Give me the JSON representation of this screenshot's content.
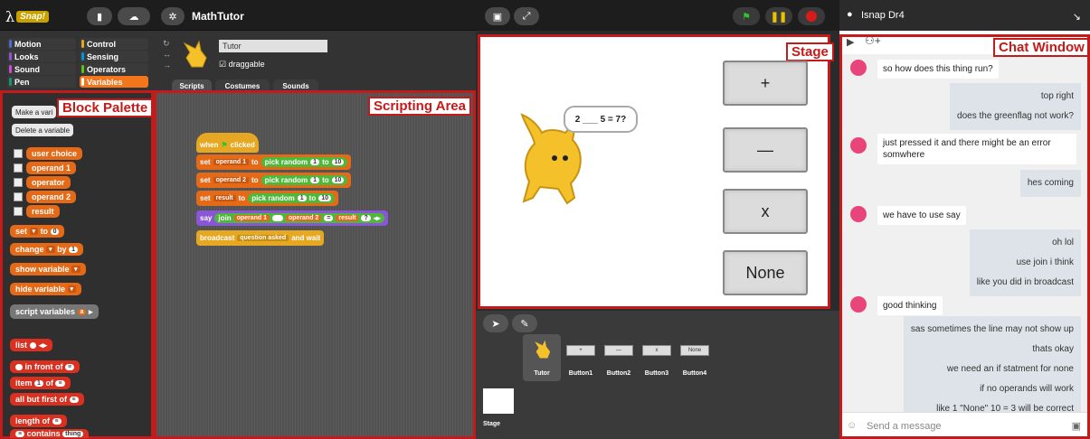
{
  "toolbar": {
    "logo": "Snap!",
    "project_name": "MathTutor"
  },
  "categories": [
    {
      "label": "Motion",
      "color": "#4a6cd4"
    },
    {
      "label": "Control",
      "color": "#e6a822"
    },
    {
      "label": "Looks",
      "color": "#8a55d7"
    },
    {
      "label": "Sensing",
      "color": "#0494dc"
    },
    {
      "label": "Sound",
      "color": "#cf4ad9"
    },
    {
      "label": "Operators",
      "color": "#62c213"
    },
    {
      "label": "Pen",
      "color": "#0e9a6c"
    },
    {
      "label": "Variables",
      "color": "#f3761d"
    }
  ],
  "sprite": {
    "name": "Tutor",
    "draggable": "draggable"
  },
  "tabs": [
    "Scripts",
    "Costumes",
    "Sounds"
  ],
  "palette": {
    "make_var": "Make a vari",
    "delete_var": "Delete a variable",
    "vars": [
      "user choice",
      "operand 1",
      "operator",
      "operand 2",
      "result"
    ],
    "set_label": "set",
    "set_to": "to",
    "set_val": "0",
    "change_label": "change",
    "change_by": "by",
    "change_val": "1",
    "show_var": "show variable",
    "hide_var": "hide variable",
    "script_vars": "script variables",
    "script_vars_a": "a",
    "list": "list",
    "in_front": "in front of",
    "item": "item",
    "item_val": "1",
    "item_of": "of",
    "all_but": "all but first of",
    "length": "length of",
    "contains": "contains",
    "contains_val": "thing"
  },
  "script": {
    "hat_when": "when",
    "hat_clicked": "clicked",
    "set": "set",
    "to": "to",
    "pick": "pick random",
    "rto": "to",
    "rows": [
      {
        "var": "operand 1",
        "a": "1",
        "b": "10"
      },
      {
        "var": "operand 2",
        "a": "1",
        "b": "10"
      },
      {
        "var": "result",
        "a": "1",
        "b": "10"
      }
    ],
    "say": "say",
    "join": "join",
    "op1": "operand 1",
    "op2": "operand 2",
    "res": "result",
    "q": "?",
    "broadcast": "broadcast",
    "msg": "question asked",
    "wait": "and wait"
  },
  "stage": {
    "bubble": "2 ___ 5 = 7?",
    "buttons": [
      "+",
      "—",
      "x",
      "None"
    ]
  },
  "corral": {
    "sprites": [
      "Tutor",
      "Button1",
      "Button2",
      "Button3",
      "Button4"
    ],
    "btn_labels": [
      "+",
      "—",
      "x",
      "None"
    ],
    "stage_label": "Stage"
  },
  "labels": {
    "palette": "Block Palette",
    "script": "Scripting Area",
    "stage": "Stage",
    "chat": "Chat Window"
  },
  "chat": {
    "title": "Isnap Dr4",
    "messages": [
      {
        "side": "L",
        "text": "so how does this thing run?"
      },
      {
        "side": "R",
        "lines": [
          "top right",
          "does the greenflag not work?"
        ]
      },
      {
        "side": "L",
        "text": "just pressed it and there might be an error somwhere"
      },
      {
        "side": "R",
        "lines": [
          "hes coming"
        ]
      },
      {
        "side": "L",
        "text": "we have  to use say"
      },
      {
        "side": "R",
        "lines": [
          "oh lol",
          "use join i think",
          "like you did in broadcast"
        ]
      },
      {
        "side": "L",
        "text": "good thinking"
      },
      {
        "side": "R",
        "lines": [
          "sas sometimes the line may not show up",
          "thats okay",
          "we need an if statment for none",
          "if no operands will work",
          "like 1 \"None\" 10 = 3 will be correct"
        ]
      }
    ],
    "placeholder": "Send a message"
  }
}
